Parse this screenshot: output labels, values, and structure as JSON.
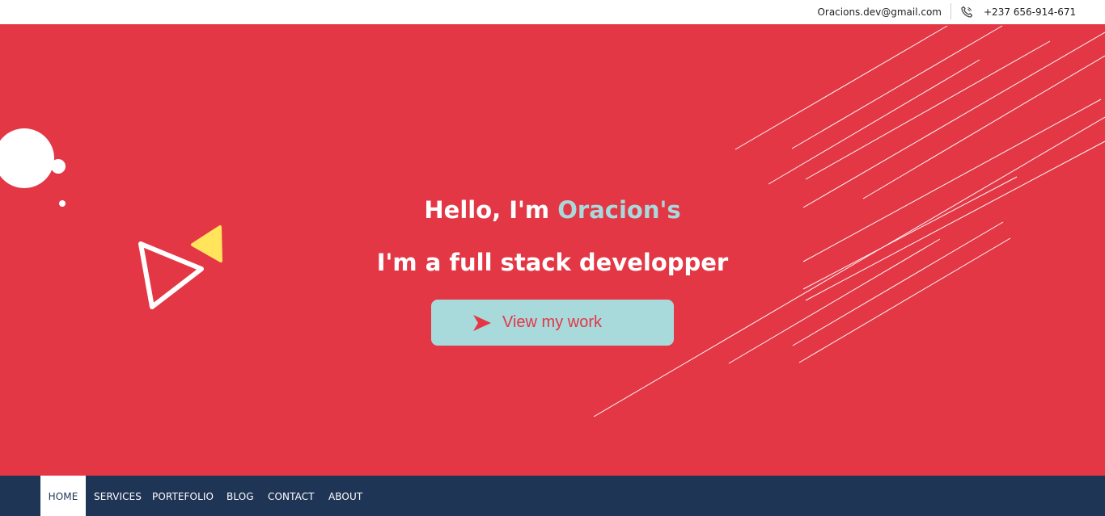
{
  "topbar": {
    "email": "Oracions.dev@gmail.com",
    "phone": "+237 656-914-671"
  },
  "hero": {
    "greeting_prefix": "Hello, I'm ",
    "greeting_name": "Oracion's",
    "tagline": "I'm a full stack developper",
    "cta_label": "View my work"
  },
  "nav": {
    "items": [
      {
        "label": "HOME",
        "active": true
      },
      {
        "label": "SERVICES",
        "active": false
      },
      {
        "label": "PORTEFOLIO",
        "active": false
      },
      {
        "label": "BLOG",
        "active": false
      },
      {
        "label": "CONTACT",
        "active": false
      },
      {
        "label": "ABOUT",
        "active": false
      }
    ]
  },
  "colors": {
    "hero_bg": "#e43746",
    "accent": "#a8d9db",
    "nav_bg": "#1f3556",
    "triangle_yellow": "#ffe45c"
  },
  "icons": [
    "phone-icon",
    "arrow-right-icon"
  ]
}
